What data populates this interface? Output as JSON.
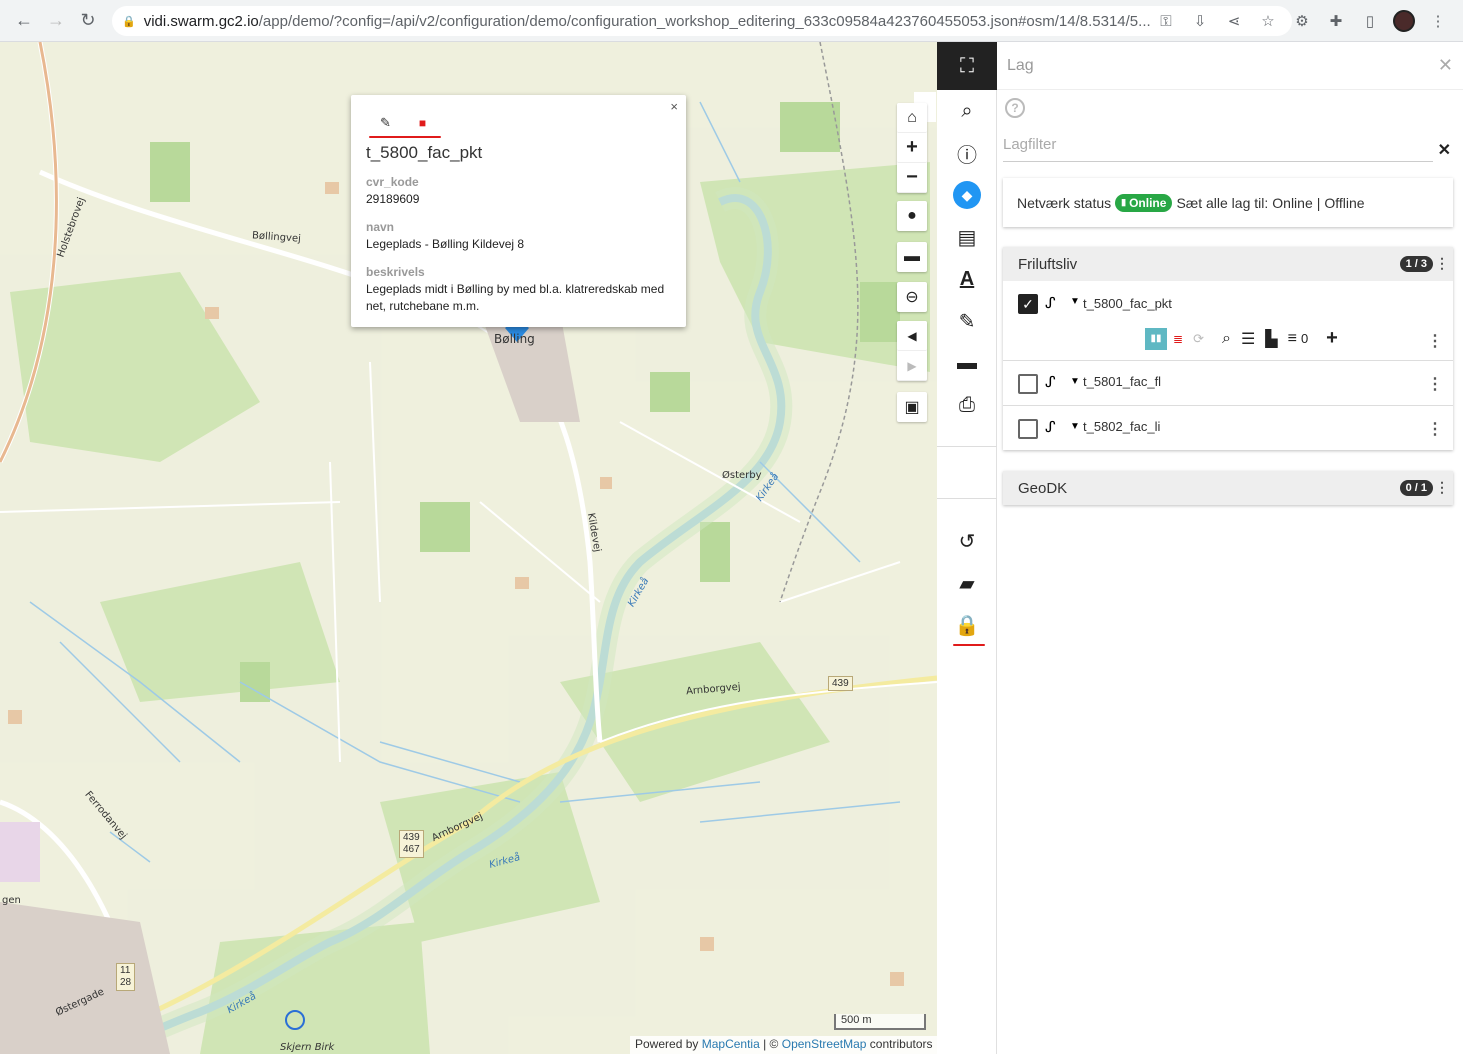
{
  "browser": {
    "url_host": "vidi.swarm.gc2.io",
    "url_path": "/app/demo/?config=/api/v2/configuration/demo/configuration_workshop_editering_633c09584a423760455053.json#osm/14/8.5314/5..."
  },
  "map": {
    "labels": {
      "bolling_vej": "Bøllingvej",
      "holstebrovej": "Holstebrovej",
      "osterby": "Østerby",
      "kildevej": "Kildevej",
      "kirkea1": "Kirkeå",
      "kirkea2": "Kirkeå",
      "kirkea3": "Kirkeå",
      "kirkea4": "Kirkeå",
      "arnborgvej1": "Arnborgvej",
      "arnborgvej2": "Arnborgvej",
      "ferrodanvej": "Ferrodanvej",
      "ostergade": "Østergade",
      "skjern_birk": "Skjern Birk",
      "bolling": "Bølling",
      "gen": "gen"
    },
    "shields": {
      "s439a": "439",
      "s439b": "439",
      "s467": "467",
      "s11": "11",
      "s28": "28"
    },
    "scale": "500 m",
    "attribution": {
      "prefix": "Powered by",
      "mapcentia": "MapCentia",
      "mid": "| ©",
      "osm": "OpenStreetMap",
      "suffix": "contributors"
    }
  },
  "popup": {
    "title": "t_5800_fac_pkt",
    "close": "×",
    "fields": [
      {
        "label": "cvr_kode",
        "value": "29189609"
      },
      {
        "label": "navn",
        "value": "Legeplads - Bølling Kildevej 8"
      },
      {
        "label": "beskrivels",
        "value": "Legeplads midt i Bølling by med bl.a. klatreredskab med net, rutchebane m.m."
      }
    ]
  },
  "panel": {
    "title": "Lag",
    "help": "?",
    "filter_placeholder": "Lagfilter",
    "network": {
      "label": "Netværk status",
      "badge": "Online",
      "set_all": "Sæt alle lag til:",
      "online": "Online",
      "sep": "|",
      "offline": "Offline"
    },
    "groups": [
      {
        "name": "Friluftsliv",
        "count": "1 / 3",
        "layers": [
          {
            "name": "t_5800_fac_pkt",
            "checked": true,
            "filter_count": "0"
          },
          {
            "name": "t_5801_fac_fl",
            "checked": false
          },
          {
            "name": "t_5802_fac_li",
            "checked": false
          }
        ]
      },
      {
        "name": "GeoDK",
        "count": "0 / 1"
      }
    ]
  },
  "colors": {
    "accent": "#2196f3",
    "online": "#28a745",
    "annotation": "#e01b1b",
    "rail_top": "#222222"
  }
}
